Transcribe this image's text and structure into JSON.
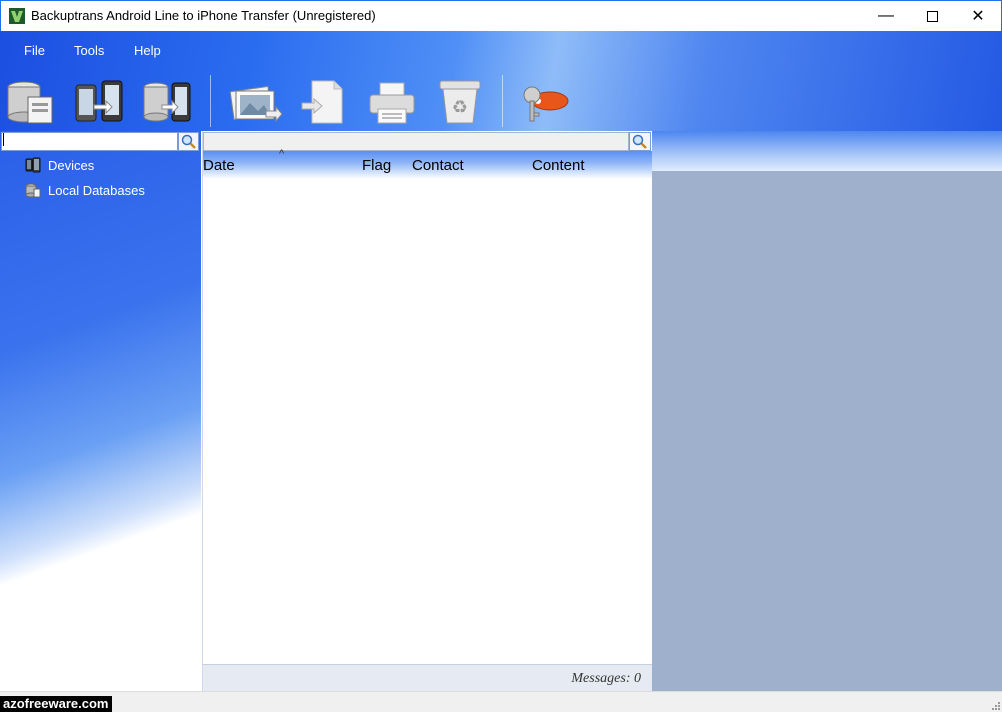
{
  "window": {
    "title": "Backuptrans Android Line to iPhone Transfer (Unregistered)",
    "controls": {
      "minimize": "—",
      "close": "✕"
    }
  },
  "menu": [
    "File",
    "Tools",
    "Help"
  ],
  "toolbar": {
    "buttons": [
      "backup-icon",
      "transfer-android-to-iphone-icon",
      "transfer-database-to-iphone-icon",
      "export-photos-icon",
      "export-document-icon",
      "print-icon",
      "recycle-bin-icon",
      "register-key-icon"
    ]
  },
  "left_panel": {
    "search_placeholder": "",
    "tree": [
      {
        "label": "Devices",
        "icon": "devices-icon"
      },
      {
        "label": "Local Databases",
        "icon": "local-databases-icon"
      }
    ]
  },
  "message_list": {
    "columns": [
      "Date",
      "Flag",
      "Contact",
      "Content"
    ],
    "sort_indicator": "^",
    "rows": [],
    "status": "Messages: 0"
  },
  "watermark": "azofreeware.com"
}
